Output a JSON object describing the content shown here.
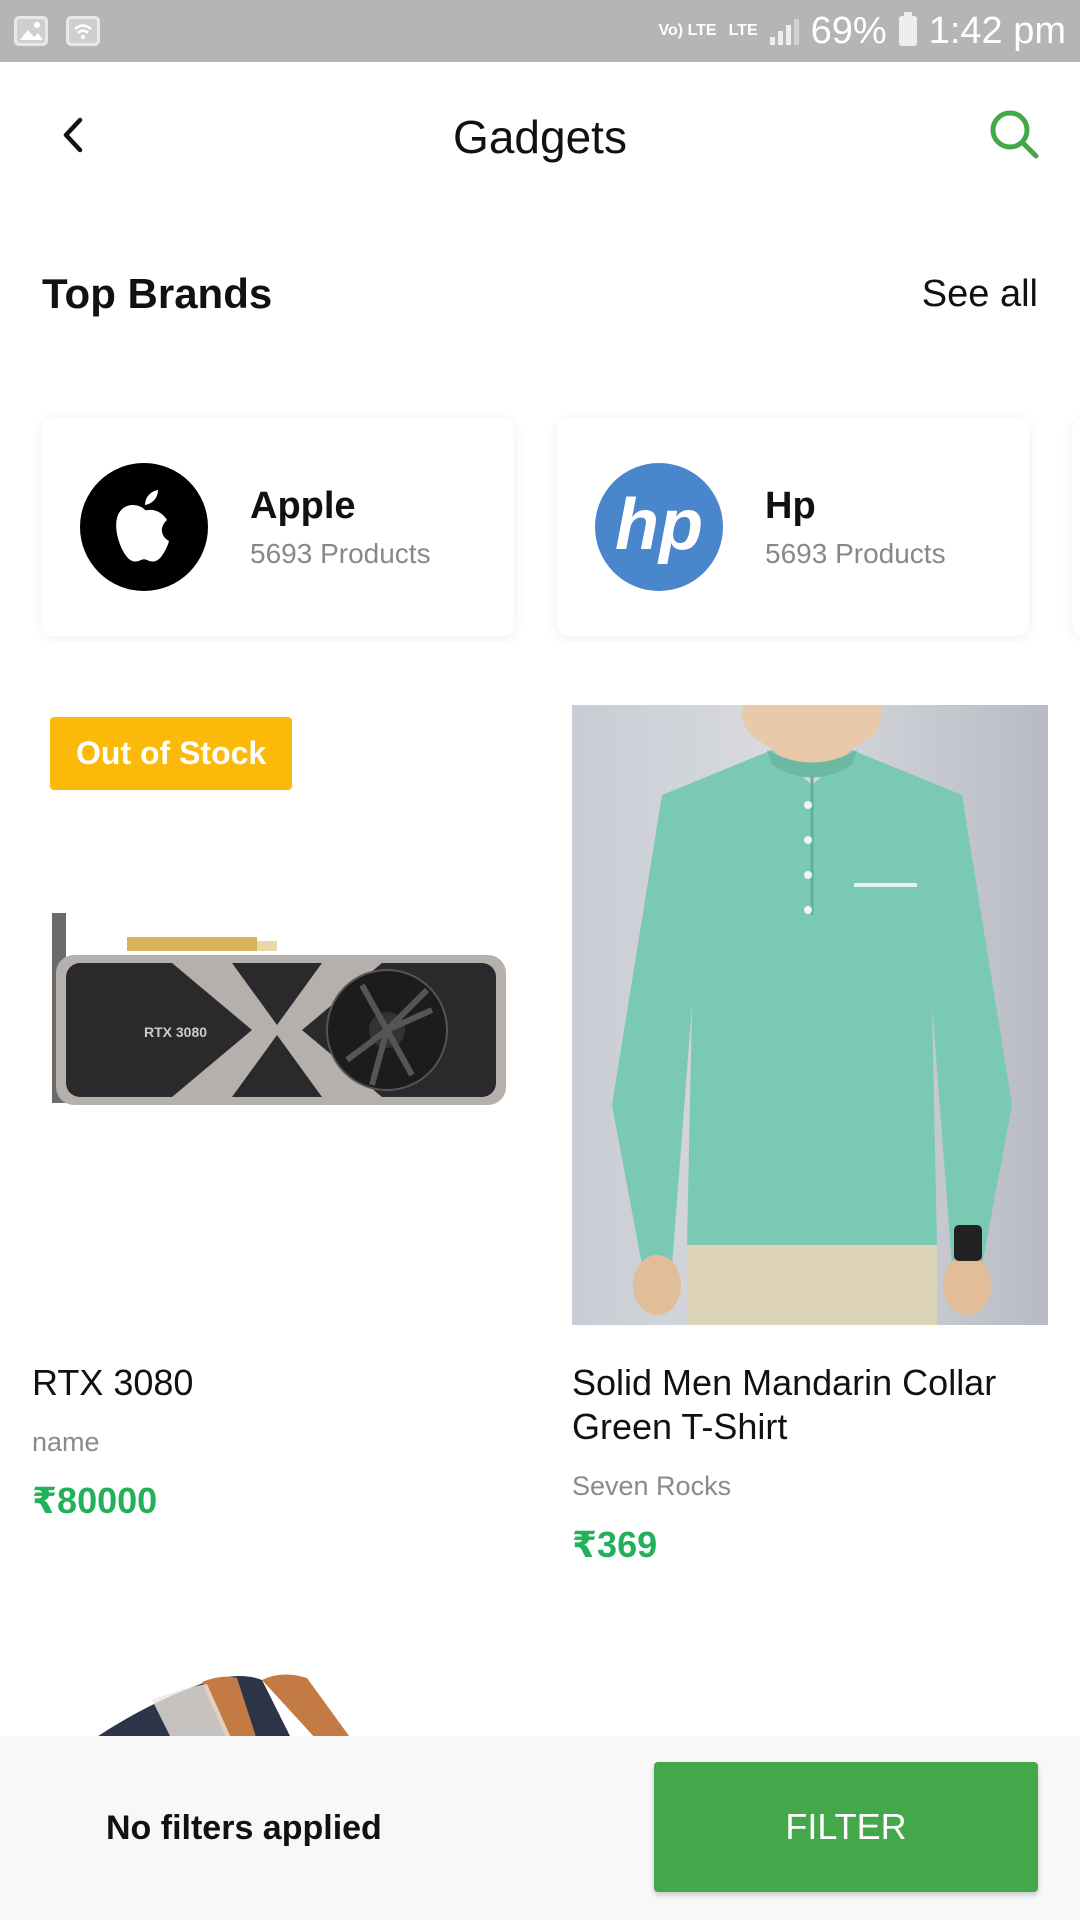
{
  "status_bar": {
    "network_label_1": "Vo) LTE",
    "network_label_2": "LTE",
    "battery": "69%",
    "time": "1:42 pm"
  },
  "app_bar": {
    "title": "Gadgets",
    "back_icon": "chevron-left-icon",
    "search_icon": "search-icon",
    "accent_color": "#43a84a"
  },
  "top_brands": {
    "title": "Top Brands",
    "see_all_label": "See all",
    "brands": [
      {
        "name": "Apple",
        "count": "5693 Products",
        "logo": "apple-logo"
      },
      {
        "name": "Hp",
        "count": "5693 Products",
        "logo": "hp-logo"
      }
    ]
  },
  "products": [
    {
      "name": "RTX 3080",
      "brand": "name",
      "price": "₹80000",
      "badge": "Out of Stock",
      "image_label": "RTX 3080"
    },
    {
      "name": "Solid Men Mandarin Collar Green T-Shirt",
      "brand": "Seven Rocks",
      "price": "₹369"
    }
  ],
  "bottom_bar": {
    "filter_status": "No filters applied",
    "filter_button": "FILTER"
  },
  "colors": {
    "price_green": "#22b05a",
    "badge_yellow": "#fbb90a",
    "filter_green": "#43a84a"
  }
}
